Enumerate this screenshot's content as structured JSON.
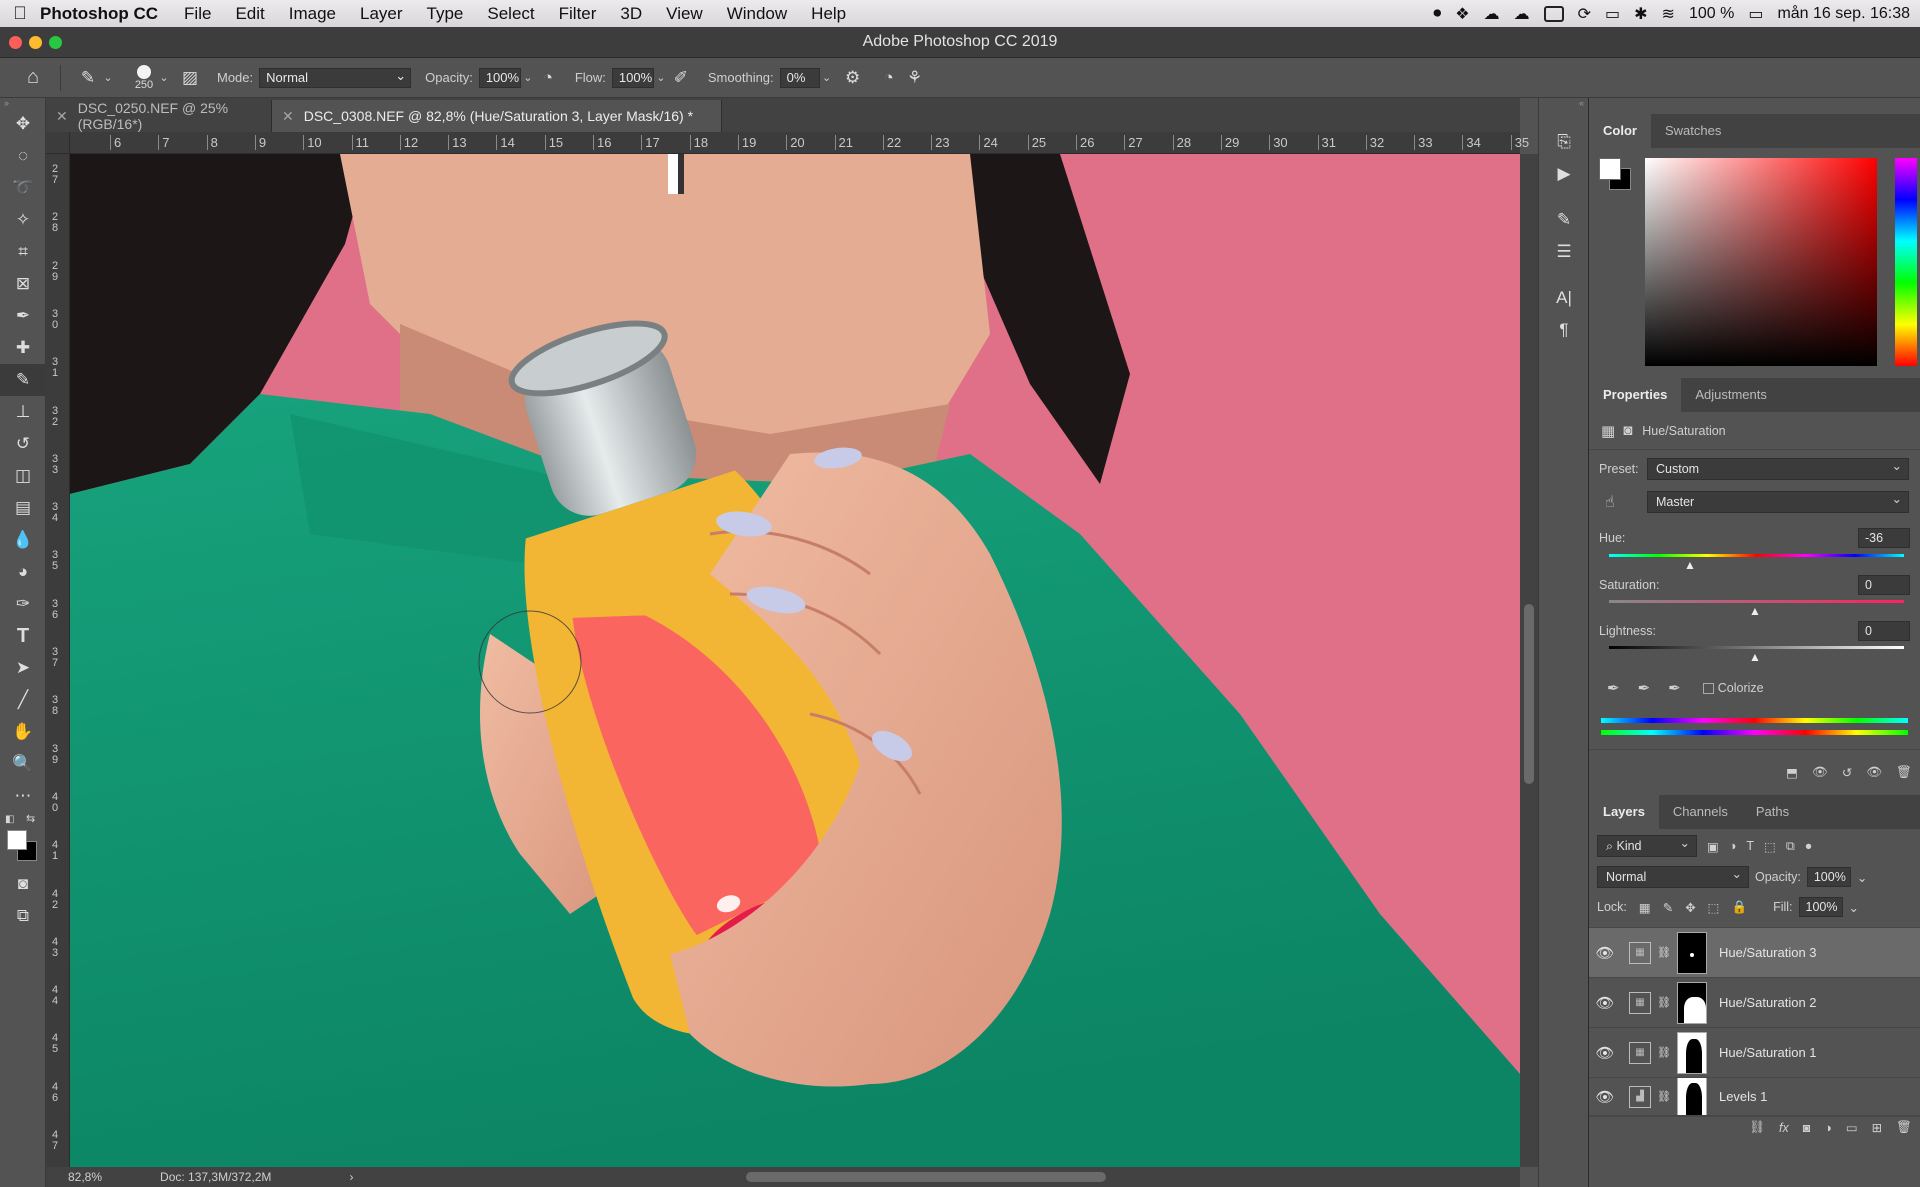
{
  "menubar": {
    "app_name": "Photoshop CC",
    "items": [
      "File",
      "Edit",
      "Image",
      "Layer",
      "Type",
      "Select",
      "Filter",
      "3D",
      "View",
      "Window",
      "Help"
    ],
    "battery": "100 %",
    "datetime": "mån 16 sep.  16:38"
  },
  "window": {
    "title": "Adobe Photoshop CC 2019"
  },
  "options": {
    "brush_size": "250",
    "mode_label": "Mode:",
    "mode_value": "Normal",
    "opacity_label": "Opacity:",
    "opacity_value": "100%",
    "flow_label": "Flow:",
    "flow_value": "100%",
    "smoothing_label": "Smoothing:",
    "smoothing_value": "0%"
  },
  "tabs": [
    {
      "label": "DSC_0250.NEF @ 25% (RGB/16*)",
      "active": false
    },
    {
      "label": "DSC_0308.NEF @ 82,8% (Hue/Saturation 3, Layer Mask/16) *",
      "active": true
    }
  ],
  "ruler": {
    "h_ticks": [
      "6",
      "7",
      "8",
      "9",
      "10",
      "11",
      "12",
      "13",
      "14",
      "15",
      "16",
      "17",
      "18",
      "19",
      "20",
      "21",
      "22",
      "23",
      "24",
      "25",
      "26",
      "27",
      "28",
      "29",
      "30",
      "31",
      "32",
      "33",
      "34",
      "35"
    ],
    "v_ticks": [
      "2\n7",
      "2\n8",
      "2\n9",
      "3\n0",
      "3\n1",
      "3\n2",
      "3\n3",
      "3\n4",
      "3\n5",
      "3\n6",
      "3\n7",
      "3\n8",
      "3\n9",
      "4\n0",
      "4\n1",
      "4\n2",
      "4\n3",
      "4\n4",
      "4\n5",
      "4\n6",
      "4\n7"
    ]
  },
  "status": {
    "zoom": "82,8%",
    "doc": "Doc: 137,3M/372,2M"
  },
  "color_panel": {
    "tabs": [
      "Color",
      "Swatches"
    ]
  },
  "properties": {
    "tabs": [
      "Properties",
      "Adjustments"
    ],
    "title": "Hue/Saturation",
    "preset_label": "Preset:",
    "preset_value": "Custom",
    "channel_value": "Master",
    "hue_label": "Hue:",
    "hue_value": "-36",
    "saturation_label": "Saturation:",
    "saturation_value": "0",
    "lightness_label": "Lightness:",
    "lightness_value": "0",
    "colorize_label": "Colorize"
  },
  "layers_panel": {
    "tabs": [
      "Layers",
      "Channels",
      "Paths"
    ],
    "filter_value": "Kind",
    "blend_value": "Normal",
    "opacity_label": "Opacity:",
    "opacity_value": "100%",
    "lock_label": "Lock:",
    "fill_label": "Fill:",
    "fill_value": "100%",
    "layers": [
      {
        "name": "Hue/Saturation 3",
        "selected": true
      },
      {
        "name": "Hue/Saturation 2",
        "selected": false
      },
      {
        "name": "Hue/Saturation 1",
        "selected": false
      },
      {
        "name": "Levels 1",
        "selected": false
      }
    ]
  },
  "colors": {
    "ui_bg": "#535353",
    "panel_dark": "#424242",
    "pink_bg": "#e07088",
    "sweater": "#129a74",
    "juice": "#f3b634"
  }
}
